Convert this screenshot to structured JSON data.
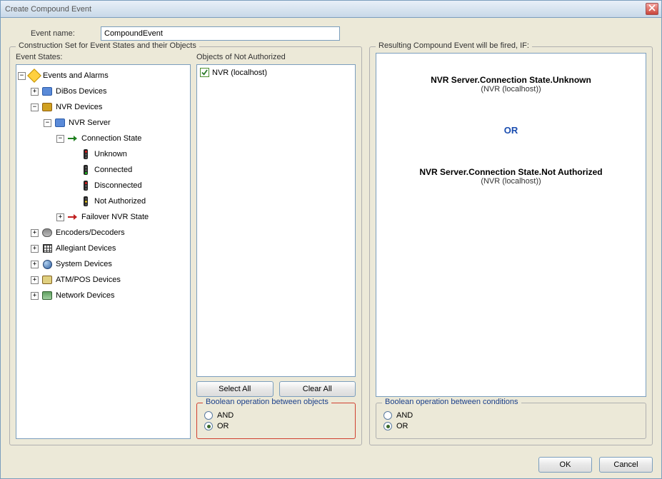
{
  "window": {
    "title": "Create Compound Event"
  },
  "eventName": {
    "label": "Event name:",
    "value": "CompoundEvent"
  },
  "leftGroup": {
    "title": "Construction Set for Event States and their Objects",
    "eventStatesLabel": "Event States:",
    "objectsLabel": "Objects of Not Authorized",
    "tree": {
      "root": "Events and Alarms",
      "dibos": "DiBos Devices",
      "nvrDevices": "NVR Devices",
      "nvrServer": "NVR Server",
      "connectionState": "Connection State",
      "unknown": "Unknown",
      "connected": "Connected",
      "disconnected": "Disconnected",
      "notAuthorized": "Not Authorized",
      "failover": "Failover NVR State",
      "encoders": "Encoders/Decoders",
      "allegiant": "Allegiant Devices",
      "system": "System Devices",
      "atm": "ATM/POS Devices",
      "network": "Network Devices"
    },
    "objectItem": "NVR (localhost)",
    "selectAll": "Select All",
    "clearAll": "Clear All",
    "boolOps": {
      "legend": "Boolean operation between objects",
      "and": "AND",
      "or": "OR"
    }
  },
  "rightGroup": {
    "title": "Resulting Compound Event will be fired, IF:",
    "cond1": {
      "title": "NVR Server.Connection State.Unknown",
      "sub": "(NVR (localhost))"
    },
    "or": "OR",
    "cond2": {
      "title": "NVR Server.Connection State.Not Authorized",
      "sub": "(NVR (localhost))"
    },
    "boolOps": {
      "legend": "Boolean operation between conditions",
      "and": "AND",
      "or": "OR"
    }
  },
  "buttons": {
    "ok": "OK",
    "cancel": "Cancel"
  }
}
